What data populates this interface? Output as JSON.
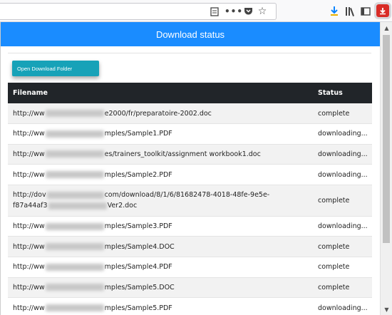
{
  "header": {
    "title": "Download status"
  },
  "open_folder_button": "Open Download Folder",
  "table": {
    "columns": [
      "Filename",
      "Status"
    ],
    "rows": [
      {
        "pre": "http://ww",
        "post": "e2000/fr/preparatoire-2002.doc",
        "blur": 82,
        "status": "complete"
      },
      {
        "pre": "http://ww",
        "post": "mples/Sample1.PDF",
        "blur": 82,
        "status": "downloading..."
      },
      {
        "pre": "http://ww",
        "post": "es/trainers_toolkit/assignment workbook1.doc",
        "blur": 82,
        "status": "downloading..."
      },
      {
        "pre": "http://ww",
        "post": "mples/Sample2.PDF",
        "blur": 82,
        "status": "downloading..."
      },
      {
        "pre": "http://dov",
        "post": "com/download/8/1/6/81682478-4018-48fe-9e5e-",
        "blur": 80,
        "line2_pre": "f87a44af3",
        "line2_post": "Ver2.doc",
        "blur2": 82,
        "status": "complete",
        "tall": true
      },
      {
        "pre": "http://ww",
        "post": "mples/Sample3.PDF",
        "blur": 82,
        "status": "downloading..."
      },
      {
        "pre": "http://ww",
        "post": "mples/Sample4.DOC",
        "blur": 82,
        "status": "complete"
      },
      {
        "pre": "http://ww",
        "post": "mples/Sample4.PDF",
        "blur": 82,
        "status": "complete"
      },
      {
        "pre": "http://ww",
        "post": "mples/Sample5.DOC",
        "blur": 82,
        "status": "complete"
      },
      {
        "pre": "http://ww",
        "post": "mples/Sample5.PDF",
        "blur": 82,
        "status": "downloading..."
      }
    ]
  },
  "toolbar": {
    "icons": [
      "reader-view-icon",
      "more-actions-icon",
      "pocket-icon",
      "bookmark-star-icon",
      "download-arrow-icon",
      "library-icon",
      "sidebar-icon",
      "extension-icon"
    ]
  },
  "colors": {
    "header": "#1a8cff",
    "button": "#17a2b8",
    "table_head": "#212529"
  }
}
